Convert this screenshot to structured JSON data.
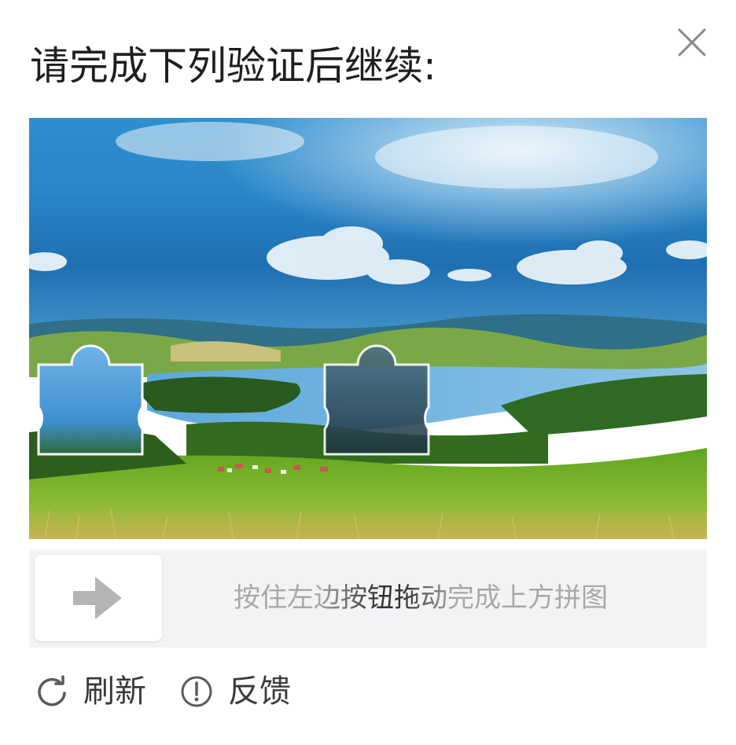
{
  "dialog": {
    "title": "请完成下列验证后继续:",
    "close_icon": "close-icon"
  },
  "puzzle": {
    "image": "landscape-lake-meadow",
    "piece_shape": "jigsaw-piece",
    "sky_color": "#1f7bbf",
    "grass_color": "#7db82f",
    "lake_color": "#6fb3de"
  },
  "slider": {
    "hint": "按住左边按钮拖动完成上方拼图",
    "knob_icon": "arrow-right-icon",
    "progress": 0
  },
  "footer": {
    "refresh_label": "刷新",
    "refresh_icon": "refresh-icon",
    "feedback_label": "反馈",
    "feedback_icon": "info-icon"
  },
  "colors": {
    "title_text": "#1f1f1f",
    "hint_text": "#a6a6a6",
    "track_bg": "#f2f3f5",
    "icon_gray": "#b4b4b4"
  }
}
